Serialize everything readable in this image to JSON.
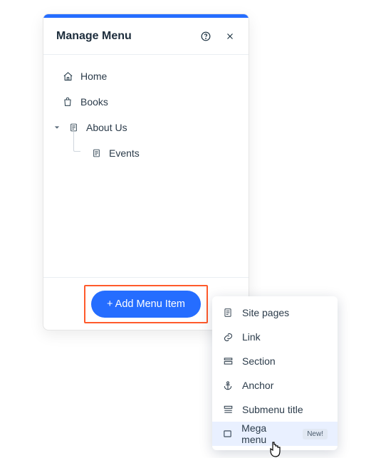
{
  "panel": {
    "title": "Manage Menu",
    "add_button_label": "+ Add Menu Item"
  },
  "tree": {
    "items": [
      {
        "label": "Home",
        "icon": "home",
        "depth": 0
      },
      {
        "label": "Books",
        "icon": "bag",
        "depth": 0
      },
      {
        "label": "About Us",
        "icon": "page",
        "depth": 0,
        "expanded": true
      },
      {
        "label": "Events",
        "icon": "page",
        "depth": 1
      }
    ]
  },
  "popup": {
    "items": [
      {
        "label": "Site pages",
        "icon": "page"
      },
      {
        "label": "Link",
        "icon": "link"
      },
      {
        "label": "Section",
        "icon": "section"
      },
      {
        "label": "Anchor",
        "icon": "anchor"
      },
      {
        "label": "Submenu title",
        "icon": "subtitle"
      },
      {
        "label": "Mega menu",
        "icon": "rect",
        "badge": "New!",
        "hovered": true
      }
    ]
  }
}
